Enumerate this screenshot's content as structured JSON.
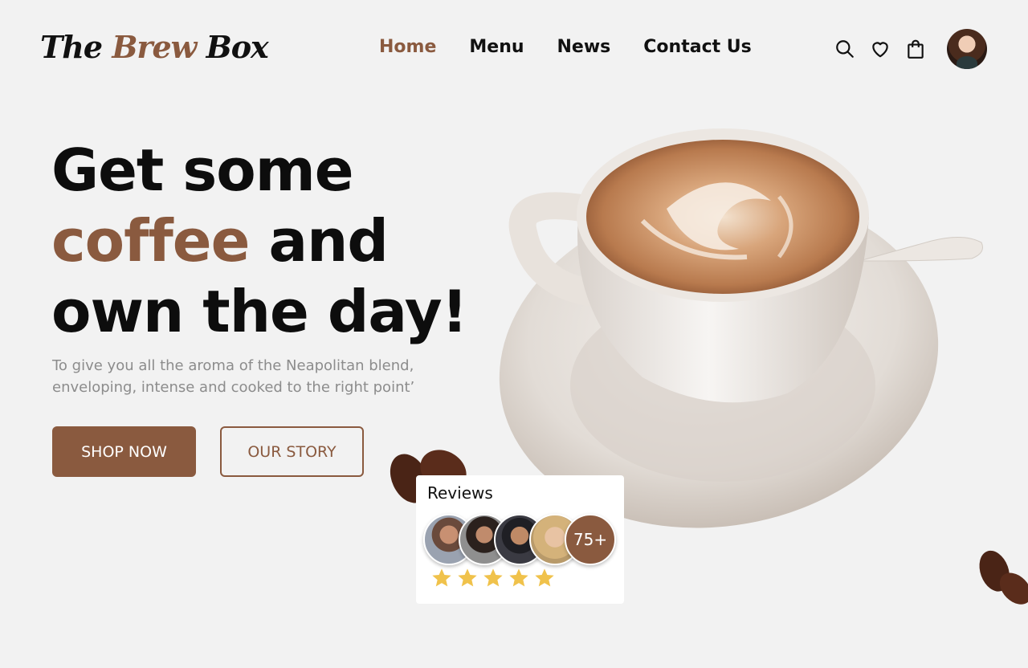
{
  "brand": {
    "name_part1": "The ",
    "name_accent": "Brew",
    "name_part3": " Box"
  },
  "nav": {
    "items": [
      {
        "label": "Home",
        "active": true
      },
      {
        "label": "Menu",
        "active": false
      },
      {
        "label": "News",
        "active": false
      },
      {
        "label": "Contact Us",
        "active": false
      }
    ]
  },
  "header_icons": [
    "search-icon",
    "heart-icon",
    "shopping-bag-icon"
  ],
  "hero": {
    "line1": "Get some",
    "line2_accent": "coffee",
    "line2_rest": " and",
    "line3": "own the day!",
    "subtitle": "To give you all the aroma of the Neapolitan blend, enveloping, intense and cooked to the right point’",
    "primary_button": "SHOP NOW",
    "secondary_button": "OUR STORY"
  },
  "reviews": {
    "title": "Reviews",
    "more_count": "75+",
    "rating": 5
  },
  "colors": {
    "accent": "#8a5a3f",
    "background": "#f2f2f2",
    "star": "#f0c24b"
  }
}
